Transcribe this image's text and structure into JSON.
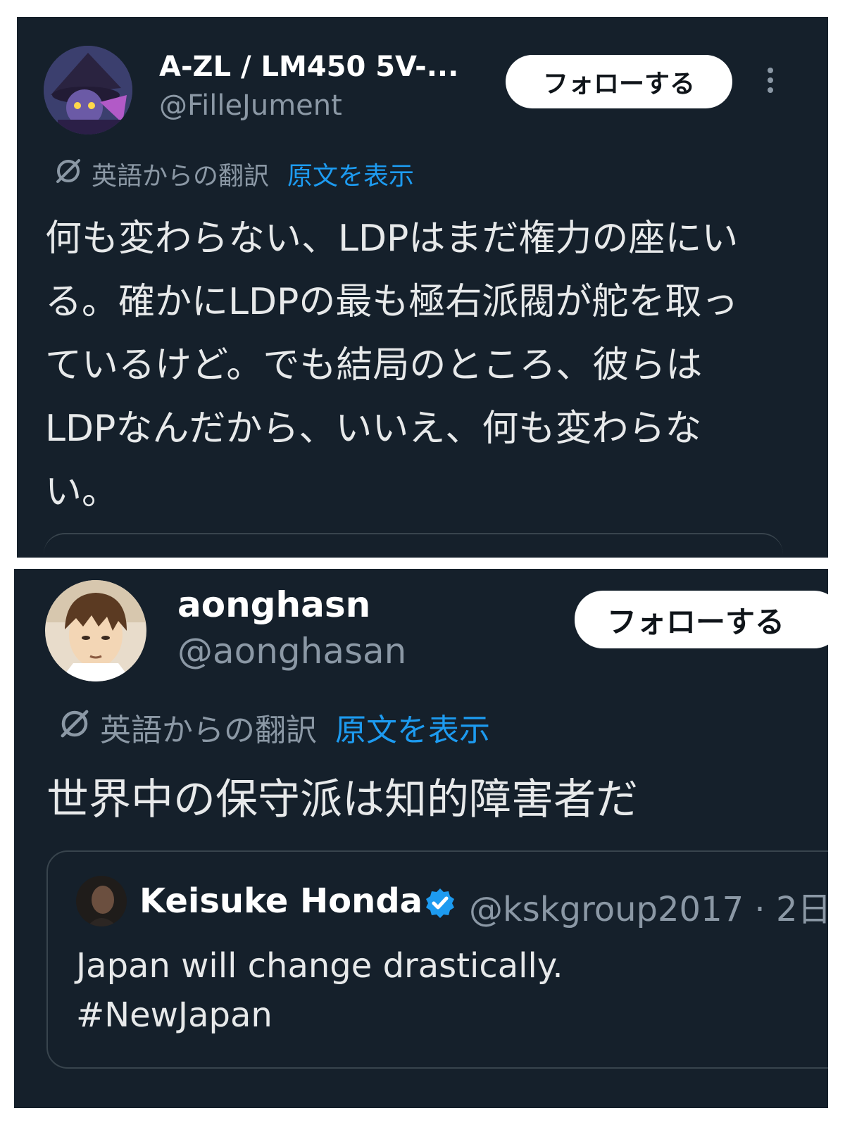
{
  "tweets": [
    {
      "display_name": "A-ZL / LM450 5V-...",
      "handle": "@FilleJument",
      "follow_label": "フォローする",
      "translation_label": "英語からの翻訳",
      "show_original_label": "原文を表示",
      "body": "何も変わらない、LDPはまだ権力の座にいる。確かにLDPの最も極右派閥が舵を取っているけど。でも結局のところ、彼らはLDPなんだから、いいえ、何も変わらない。",
      "avatar_icon": "witch-character-avatar",
      "more_icon": "more-vertical-icon"
    },
    {
      "display_name": "aonghasn",
      "handle": "@aonghasan",
      "follow_label": "フォローする",
      "translation_label": "英語からの翻訳",
      "show_original_label": "原文を表示",
      "body": "世界中の保守派は知的障害者だ",
      "avatar_icon": "anime-boy-avatar",
      "quote": {
        "display_name": "Keisuke Honda",
        "verified_icon": "verified-badge-icon",
        "handle_time": "@kskgroup2017 · 2日",
        "text_line1": "Japan will change drastically.",
        "text_line2": "#NewJapan",
        "avatar_icon": "person-photo-avatar"
      }
    }
  ],
  "colors": {
    "background": "#15202b",
    "text": "#e7e9ea",
    "secondary": "#8b98a5",
    "link": "#1d9bf0",
    "verified": "#1d9bf0",
    "border": "#38444d"
  }
}
